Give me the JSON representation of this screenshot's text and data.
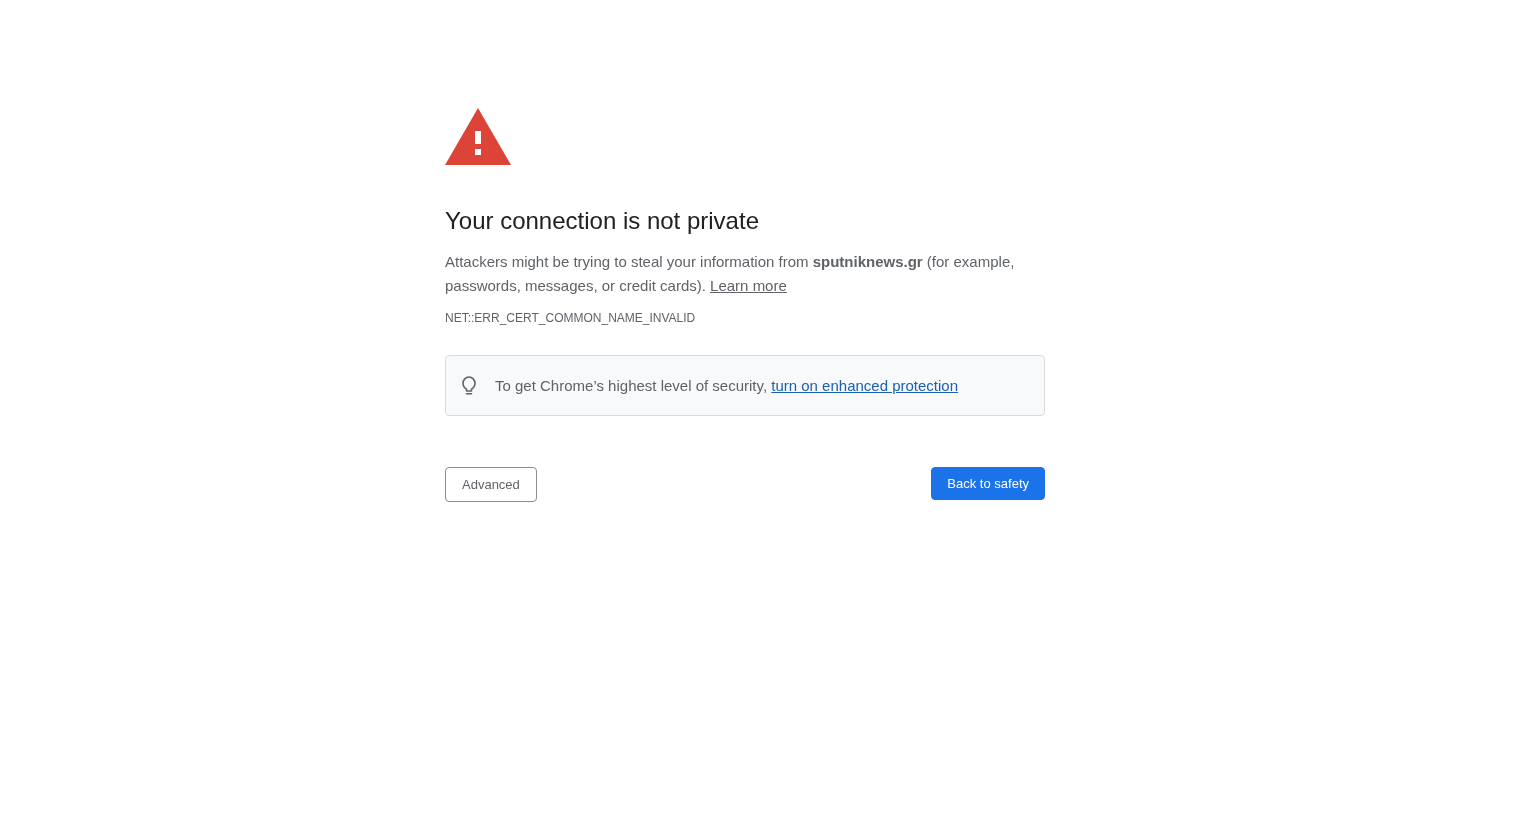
{
  "heading": "Your connection is not private",
  "message": "Attackers might be trying to steal your information from **sputniknews.gr** (for example, passwords, messages, or credit cards).",
  "learn_more_link": "Learn more",
  "error_code": "NET::ERR_CERT_COMMON_NAME_INVALID",
  "callout": {
    "text": "To get Chrome’s highest level of security,",
    "link": "turn on enhanced protection"
  },
  "buttons": [
    {
      "label": "Advanced",
      "kind": "secondary"
    },
    {
      "label": "Back to safety",
      "kind": "primary"
    }
  ]
}
